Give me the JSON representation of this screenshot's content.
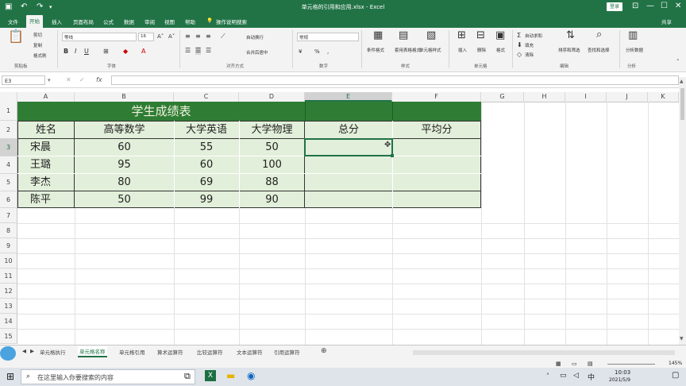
{
  "titlebar": {
    "title": "单元格的引用和应用.xlsx - Excel",
    "login": "登录",
    "ctrls": [
      "⊡",
      "—",
      "☐",
      "✕"
    ]
  },
  "menu": {
    "items": [
      "文件",
      "开始",
      "插入",
      "页面布局",
      "公式",
      "数据",
      "审阅",
      "视图",
      "帮助",
      "操作说明搜索"
    ],
    "share": "共享",
    "active_index": 1
  },
  "ribbon": {
    "clipboard": {
      "cut": "剪切",
      "copy": "复制",
      "paste_format": "格式刷",
      "label": "剪贴板"
    },
    "font": {
      "name": "等线",
      "size": "16",
      "label": "字体"
    },
    "align": {
      "wrap": "自动换行",
      "merge": "合并后居中",
      "label": "对齐方式"
    },
    "number": {
      "format": "常规",
      "label": "数字"
    },
    "styles": {
      "cond": "条件格式",
      "table": "套用表格格式",
      "cell": "单元格样式",
      "label": "样式"
    },
    "cells": {
      "insert": "插入",
      "delete": "删除",
      "format": "格式",
      "label": "单元格"
    },
    "editing": {
      "autosum": "自动求和",
      "fill": "填充",
      "clear": "清除",
      "sort": "排序和筛选",
      "find": "查找和选择",
      "label": "编辑"
    },
    "analysis": {
      "label": "分析数据",
      "group": "分析"
    }
  },
  "formula_bar": {
    "name_box": "E3",
    "fx": "fx",
    "value": ""
  },
  "columns": [
    "A",
    "B",
    "C",
    "D",
    "E",
    "F",
    "G",
    "H",
    "I",
    "J",
    "K"
  ],
  "rows": [
    "1",
    "2",
    "3",
    "4",
    "5",
    "6",
    "7",
    "8",
    "9",
    "10",
    "11",
    "12",
    "13",
    "14",
    "15",
    "16",
    "17"
  ],
  "table": {
    "title": "学生成绩表",
    "headers": [
      "姓名",
      "高等数学",
      "大学英语",
      "大学物理",
      "总分",
      "平均分"
    ],
    "records": [
      [
        "宋晨",
        "60",
        "55",
        "50"
      ],
      [
        "王璐",
        "95",
        "60",
        "100"
      ],
      [
        "李杰",
        "80",
        "69",
        "88"
      ],
      [
        "陈平",
        "50",
        "99",
        "90"
      ]
    ]
  },
  "sheet_tabs": {
    "items": [
      "单元格执行",
      "单元格名称",
      "单元格引用",
      "算术运算符",
      "比较运算符",
      "文本运算符",
      "引用运算符"
    ],
    "active_index": 1,
    "add": "⊕"
  },
  "status": {
    "zoom": "145%"
  },
  "taskbar": {
    "search_placeholder": "在这里输入你要搜索的内容",
    "time": "10:03",
    "date": "2021/5/9"
  },
  "colors": {
    "brand": "#217346",
    "band": "#e2efda",
    "title_band": "#2f7d35"
  }
}
